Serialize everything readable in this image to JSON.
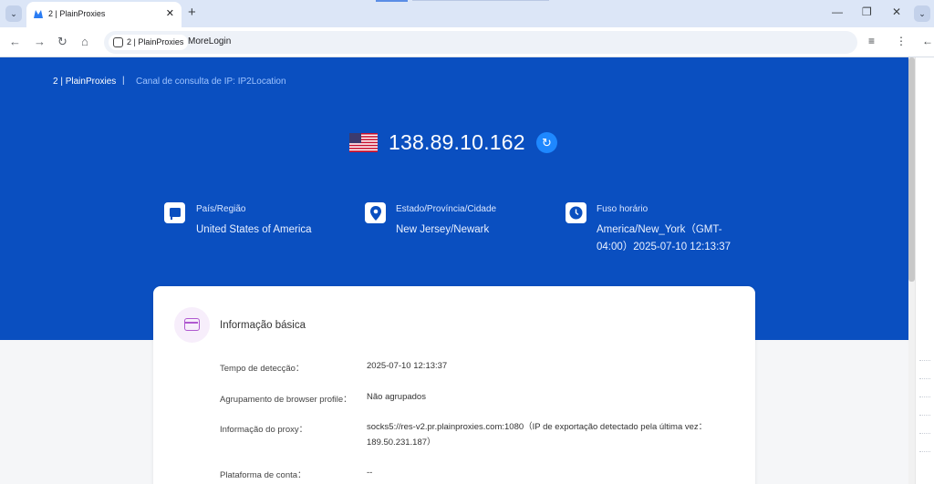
{
  "browser": {
    "tab_title": "2 | PlainProxies",
    "profile_chip": "2 | PlainProxies",
    "address_text": "MoreLogin"
  },
  "header": {
    "crumb_profile": "2 | PlainProxies",
    "crumb_separator": "|",
    "crumb_channel": "Canal de consulta de IP: IP2Location"
  },
  "ip_panel": {
    "ip": "138.89.10.162",
    "flag": "us-flag-icon"
  },
  "geo": {
    "country_label": "País/Região",
    "country_value": "United States of America",
    "region_label": "Estado/Província/Cidade",
    "region_value": "New Jersey/Newark",
    "timezone_label": "Fuso horário",
    "timezone_value_line1": "America/New_York（GMT-",
    "timezone_value_line2": "04:00）2025-07-10 12:13:37"
  },
  "basic_info": {
    "title": "Informação básica",
    "rows": [
      {
        "label": "Tempo de detecção：",
        "value": "2025-07-10 12:13:37"
      },
      {
        "label": "Agrupamento de browser profile：",
        "value": "Não agrupados"
      },
      {
        "label": "Informação do proxy：",
        "value": "socks5://res-v2.pr.plainproxies.com:1080（IP de exportação detectado pela última vez：",
        "value2": "189.50.231.187）"
      },
      {
        "label": "Plataforma de conta：",
        "value": "--"
      }
    ]
  },
  "colors": {
    "hero_bg": "#0a4fc0",
    "accent": "#1e88ff",
    "card_icon": "#b05ad0"
  }
}
